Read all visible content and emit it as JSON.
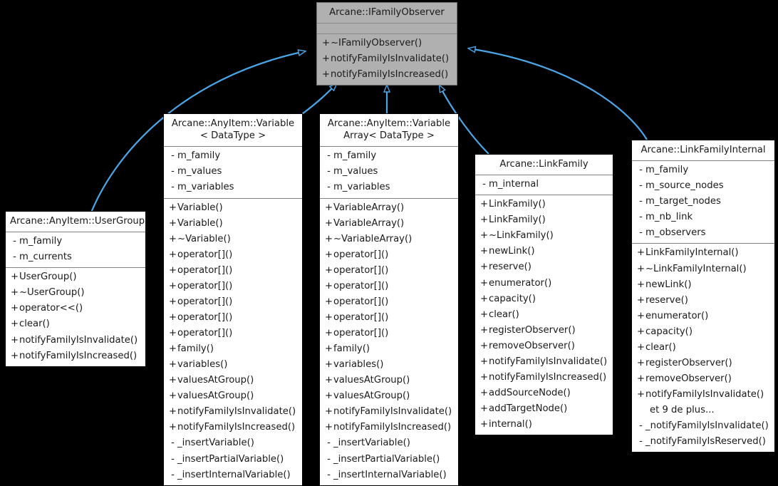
{
  "diagram": {
    "kind": "uml-class-inheritance",
    "background": "#000000",
    "edge_color": "#4ba6e8",
    "base_fill": "#b0b0b0",
    "class_fill": "#ffffff"
  },
  "classes": {
    "ifamilyobserver": {
      "title_lines": [
        "Arcane::IFamilyObserver"
      ],
      "attributes": [],
      "methods": [
        {
          "vis": "+",
          "name": "~IFamilyObserver()"
        },
        {
          "vis": "+",
          "name": "notifyFamilyIsInvalidate()"
        },
        {
          "vis": "+",
          "name": "notifyFamilyIsIncreased()"
        }
      ]
    },
    "usergroup": {
      "title_lines": [
        "Arcane::AnyItem::UserGroup"
      ],
      "attributes": [
        {
          "vis": "-",
          "name": "m_family"
        },
        {
          "vis": "-",
          "name": "m_currents"
        }
      ],
      "methods": [
        {
          "vis": "+",
          "name": "UserGroup()"
        },
        {
          "vis": "+",
          "name": "~UserGroup()"
        },
        {
          "vis": "+",
          "name": "operator<<()"
        },
        {
          "vis": "+",
          "name": "clear()"
        },
        {
          "vis": "+",
          "name": "notifyFamilyIsInvalidate()"
        },
        {
          "vis": "+",
          "name": "notifyFamilyIsIncreased()"
        }
      ]
    },
    "variable": {
      "title_lines": [
        "Arcane::AnyItem::Variable",
        "< DataType >"
      ],
      "attributes": [
        {
          "vis": "-",
          "name": "m_family"
        },
        {
          "vis": "-",
          "name": "m_values"
        },
        {
          "vis": "-",
          "name": "m_variables"
        }
      ],
      "methods": [
        {
          "vis": "+",
          "name": "Variable()"
        },
        {
          "vis": "+",
          "name": "Variable()"
        },
        {
          "vis": "+",
          "name": "~Variable()"
        },
        {
          "vis": "+",
          "name": "operator[]()"
        },
        {
          "vis": "+",
          "name": "operator[]()"
        },
        {
          "vis": "+",
          "name": "operator[]()"
        },
        {
          "vis": "+",
          "name": "operator[]()"
        },
        {
          "vis": "+",
          "name": "operator[]()"
        },
        {
          "vis": "+",
          "name": "operator[]()"
        },
        {
          "vis": "+",
          "name": "family()"
        },
        {
          "vis": "+",
          "name": "variables()"
        },
        {
          "vis": "+",
          "name": "valuesAtGroup()"
        },
        {
          "vis": "+",
          "name": "valuesAtGroup()"
        },
        {
          "vis": "+",
          "name": "notifyFamilyIsInvalidate()"
        },
        {
          "vis": "+",
          "name": "notifyFamilyIsIncreased()"
        },
        {
          "vis": "-",
          "name": "_insertVariable()"
        },
        {
          "vis": "-",
          "name": "_insertPartialVariable()"
        },
        {
          "vis": "-",
          "name": "_insertInternalVariable()"
        }
      ]
    },
    "variablearray": {
      "title_lines": [
        "Arcane::AnyItem::Variable",
        "Array< DataType >"
      ],
      "attributes": [
        {
          "vis": "-",
          "name": "m_family"
        },
        {
          "vis": "-",
          "name": "m_values"
        },
        {
          "vis": "-",
          "name": "m_variables"
        }
      ],
      "methods": [
        {
          "vis": "+",
          "name": "VariableArray()"
        },
        {
          "vis": "+",
          "name": "VariableArray()"
        },
        {
          "vis": "+",
          "name": "~VariableArray()"
        },
        {
          "vis": "+",
          "name": "operator[]()"
        },
        {
          "vis": "+",
          "name": "operator[]()"
        },
        {
          "vis": "+",
          "name": "operator[]()"
        },
        {
          "vis": "+",
          "name": "operator[]()"
        },
        {
          "vis": "+",
          "name": "operator[]()"
        },
        {
          "vis": "+",
          "name": "operator[]()"
        },
        {
          "vis": "+",
          "name": "family()"
        },
        {
          "vis": "+",
          "name": "variables()"
        },
        {
          "vis": "+",
          "name": "valuesAtGroup()"
        },
        {
          "vis": "+",
          "name": "valuesAtGroup()"
        },
        {
          "vis": "+",
          "name": "notifyFamilyIsInvalidate()"
        },
        {
          "vis": "+",
          "name": "notifyFamilyIsIncreased()"
        },
        {
          "vis": "-",
          "name": "_insertVariable()"
        },
        {
          "vis": "-",
          "name": "_insertPartialVariable()"
        },
        {
          "vis": "-",
          "name": "_insertInternalVariable()"
        }
      ]
    },
    "linkfamily": {
      "title_lines": [
        "Arcane::LinkFamily"
      ],
      "attributes": [
        {
          "vis": "-",
          "name": "m_internal"
        }
      ],
      "methods": [
        {
          "vis": "+",
          "name": "LinkFamily()"
        },
        {
          "vis": "+",
          "name": "LinkFamily()"
        },
        {
          "vis": "+",
          "name": "~LinkFamily()"
        },
        {
          "vis": "+",
          "name": "newLink()"
        },
        {
          "vis": "+",
          "name": "reserve()"
        },
        {
          "vis": "+",
          "name": "enumerator()"
        },
        {
          "vis": "+",
          "name": "capacity()"
        },
        {
          "vis": "+",
          "name": "clear()"
        },
        {
          "vis": "+",
          "name": "registerObserver()"
        },
        {
          "vis": "+",
          "name": "removeObserver()"
        },
        {
          "vis": "+",
          "name": "notifyFamilyIsInvalidate()"
        },
        {
          "vis": "+",
          "name": "notifyFamilyIsIncreased()"
        },
        {
          "vis": "+",
          "name": "addSourceNode()"
        },
        {
          "vis": "+",
          "name": "addTargetNode()"
        },
        {
          "vis": "+",
          "name": "internal()"
        }
      ]
    },
    "linkfamilyinternal": {
      "title_lines": [
        "Arcane::LinkFamilyInternal"
      ],
      "attributes": [
        {
          "vis": "-",
          "name": "m_family"
        },
        {
          "vis": "-",
          "name": "m_source_nodes"
        },
        {
          "vis": "-",
          "name": "m_target_nodes"
        },
        {
          "vis": "-",
          "name": "m_nb_link"
        },
        {
          "vis": "-",
          "name": "m_observers"
        }
      ],
      "methods": [
        {
          "vis": "+",
          "name": "LinkFamilyInternal()"
        },
        {
          "vis": "+",
          "name": "~LinkFamilyInternal()"
        },
        {
          "vis": "+",
          "name": "newLink()"
        },
        {
          "vis": "+",
          "name": "reserve()"
        },
        {
          "vis": "+",
          "name": "enumerator()"
        },
        {
          "vis": "+",
          "name": "capacity()"
        },
        {
          "vis": "+",
          "name": "clear()"
        },
        {
          "vis": "+",
          "name": "registerObserver()"
        },
        {
          "vis": "+",
          "name": "removeObserver()"
        },
        {
          "vis": "+",
          "name": "notifyFamilyIsInvalidate()"
        },
        {
          "vis": "",
          "name": "et 9 de plus...",
          "continuation": true
        },
        {
          "vis": "-",
          "name": "_notifyFamilyIsInvalidate()"
        },
        {
          "vis": "-",
          "name": "_notifyFamilyIsReserved()"
        }
      ]
    }
  },
  "edges": [
    {
      "from": "usergroup",
      "to": "ifamilyobserver",
      "type": "inheritance"
    },
    {
      "from": "variable",
      "to": "ifamilyobserver",
      "type": "inheritance"
    },
    {
      "from": "variablearray",
      "to": "ifamilyobserver",
      "type": "inheritance"
    },
    {
      "from": "linkfamily",
      "to": "ifamilyobserver",
      "type": "inheritance"
    },
    {
      "from": "linkfamilyinternal",
      "to": "ifamilyobserver",
      "type": "inheritance"
    }
  ]
}
